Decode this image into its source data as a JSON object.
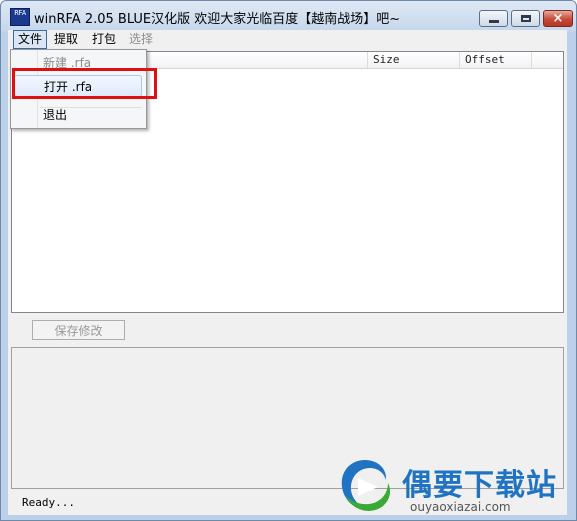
{
  "window": {
    "app_icon_text": "RFA",
    "title": "winRFA 2.05 BLUE汉化版 欢迎大家光临百度【越南战场】吧~",
    "close_glyph": "×"
  },
  "menubar": {
    "items": [
      {
        "label": "文件",
        "state": "open"
      },
      {
        "label": "提取",
        "state": "enabled"
      },
      {
        "label": "打包",
        "state": "enabled"
      },
      {
        "label": "选择",
        "state": "disabled"
      }
    ]
  },
  "file_menu": {
    "items": [
      {
        "label": "新建 .rfa",
        "state": "disabled"
      },
      {
        "label": "打开 .rfa",
        "state": "highlighted"
      },
      {
        "label": "退出",
        "state": "enabled"
      }
    ]
  },
  "listview": {
    "columns": [
      "",
      "Size",
      "Offset"
    ]
  },
  "panel": {
    "save_label": "保存修改"
  },
  "statusbar": {
    "text": "Ready..."
  },
  "watermark": {
    "title": "偶要下载站",
    "subtitle": "ouyaoxiazai.com"
  },
  "colors": {
    "highlight_border": "#e01010",
    "watermark_blue": "#1f73c2",
    "watermark_green": "#3aa935"
  }
}
